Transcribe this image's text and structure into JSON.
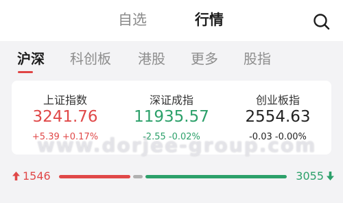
{
  "header": {
    "tabs": [
      {
        "label": "自选",
        "active": false
      },
      {
        "label": "行情",
        "active": true
      }
    ],
    "search_icon": "search-icon"
  },
  "sub_tabs": [
    {
      "label": "沪深",
      "active": true
    },
    {
      "label": "科创板",
      "active": false
    },
    {
      "label": "港股",
      "active": false
    },
    {
      "label": "更多",
      "active": false
    },
    {
      "label": "股指",
      "active": false
    }
  ],
  "indices": [
    {
      "name": "上证指数",
      "value": "3241.76",
      "change": "+5.39 +0.17%",
      "trend": "up"
    },
    {
      "name": "深证成指",
      "value": "11935.57",
      "change": "-2.55 -0.02%",
      "trend": "down"
    },
    {
      "name": "创业板指",
      "value": "2554.63",
      "change": "-0.03 -0.00%",
      "trend": "flat"
    }
  ],
  "watermark": "www.dorjee-group.com",
  "breadth": {
    "up_count": "1546",
    "down_count": "3055",
    "up_icon": "arrow-up-icon",
    "down_icon": "arrow-down-icon",
    "up_share": 0.336,
    "down_share": 0.664
  },
  "colors": {
    "up": "#e04848",
    "down": "#2ca06a",
    "flat": "#222222",
    "accent": "#e04444"
  }
}
